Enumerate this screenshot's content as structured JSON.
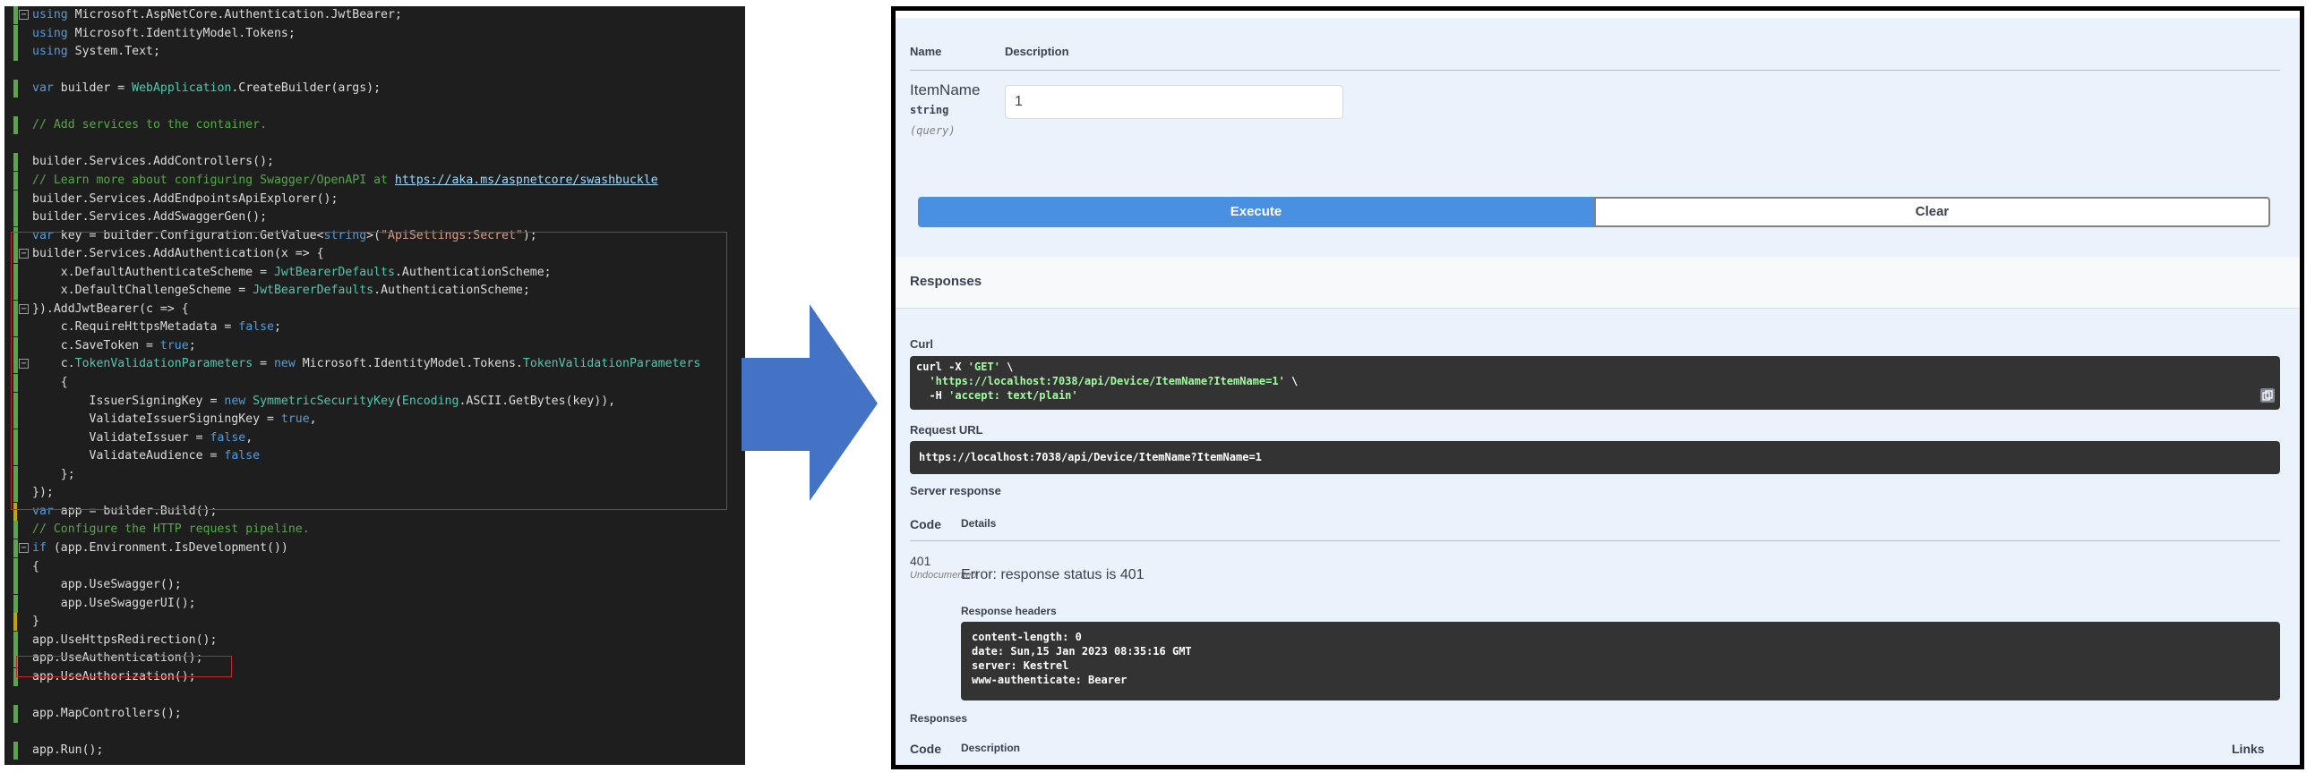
{
  "editor": {
    "lines": [
      "using Microsoft.AspNetCore.Authentication.JwtBearer;",
      "using Microsoft.IdentityModel.Tokens;",
      "using System.Text;",
      "",
      "var builder = WebApplication.CreateBuilder(args);",
      "",
      "// Add services to the container.",
      "",
      "builder.Services.AddControllers();",
      "// Learn more about configuring Swagger/OpenAPI at https://aka.ms/aspnetcore/swashbuckle",
      "builder.Services.AddEndpointsApiExplorer();",
      "builder.Services.AddSwaggerGen();",
      "var key = builder.Configuration.GetValue<string>(\"ApiSettings:Secret\");",
      "builder.Services.AddAuthentication(x => {",
      "    x.DefaultAuthenticateScheme = JwtBearerDefaults.AuthenticationScheme;",
      "    x.DefaultChallengeScheme = JwtBearerDefaults.AuthenticationScheme;",
      "}).AddJwtBearer(c => {",
      "    c.RequireHttpsMetadata = false;",
      "    c.SaveToken = true;",
      "    c.TokenValidationParameters = new Microsoft.IdentityModel.Tokens.TokenValidationParameters",
      "    {",
      "        IssuerSigningKey = new SymmetricSecurityKey(Encoding.ASCII.GetBytes(key)),",
      "        ValidateIssuerSigningKey = true,",
      "        ValidateIssuer = false,",
      "        ValidateAudience = false",
      "    };",
      "});",
      "var app = builder.Build();",
      "// Configure the HTTP request pipeline.",
      "if (app.Environment.IsDevelopment())",
      "{",
      "    app.UseSwagger();",
      "    app.UseSwaggerUI();",
      "}",
      "app.UseHttpsRedirection();",
      "app.UseAuthentication();",
      "app.UseAuthorization();",
      "",
      "app.MapControllers();",
      "",
      "app.Run();"
    ]
  },
  "swagger": {
    "params_header": {
      "name": "Name",
      "description": "Description"
    },
    "param": {
      "name": "ItemName",
      "type": "string",
      "location": "(query)",
      "value": "1"
    },
    "execute_label": "Execute",
    "clear_label": "Clear",
    "responses_title": "Responses",
    "curl_label": "Curl",
    "curl_lines": [
      "curl -X 'GET' \\",
      "  'https://localhost:7038/api/Device/ItemName?ItemName=1' \\",
      "  -H 'accept: text/plain'"
    ],
    "request_url_label": "Request URL",
    "request_url": "https://localhost:7038/api/Device/ItemName?ItemName=1",
    "server_response_label": "Server response",
    "code_header": "Code",
    "details_header": "Details",
    "status_code": "401",
    "status_note": "Undocumented",
    "error_text": "Error: response status is 401",
    "response_headers_label": "Response headers",
    "response_headers": [
      "content-length: 0",
      "date: Sun,15 Jan 2023 08:35:16 GMT",
      "server: Kestrel",
      "www-authenticate: Bearer"
    ],
    "responses_label2": "Responses",
    "code_header2": "Code",
    "description_header2": "Description",
    "links_header": "Links"
  },
  "colors": {
    "execute": "#4990e2",
    "highlight_box": "#c4262e",
    "arrow": "#4472c4"
  }
}
